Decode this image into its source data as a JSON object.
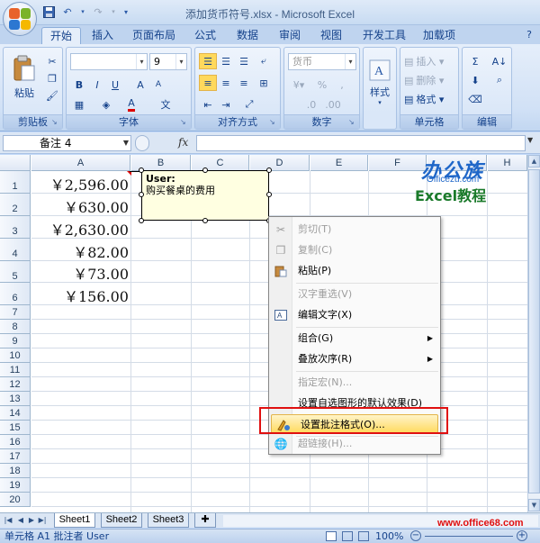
{
  "window": {
    "title": "添加货币符号.xlsx - Microsoft Excel"
  },
  "ribbon": {
    "tabs": [
      "开始",
      "插入",
      "页面布局",
      "公式",
      "数据",
      "审阅",
      "视图",
      "开发工具",
      "加载项"
    ],
    "active_tab": "开始",
    "groups": {
      "clipboard": {
        "label": "剪贴板",
        "paste_label": "粘贴"
      },
      "font": {
        "label": "字体",
        "font_size": "9",
        "bold": "B",
        "italic": "I",
        "underline": "U",
        "phonetic": "文"
      },
      "alignment": {
        "label": "对齐方式"
      },
      "number": {
        "label": "数字",
        "format": "货币",
        "percent": "%",
        "comma": ","
      },
      "styles": {
        "label": "样式"
      },
      "cells": {
        "label": "单元格",
        "insert": "插入",
        "delete": "删除",
        "format": "格式"
      },
      "editing": {
        "label": "编辑",
        "sum": "Σ"
      }
    }
  },
  "formula_bar": {
    "name_box": "备注 4",
    "fx": "fx",
    "formula": ""
  },
  "grid": {
    "columns": [
      "A",
      "B",
      "C",
      "D",
      "E",
      "F",
      "H"
    ],
    "rows": [
      "1",
      "2",
      "3",
      "4",
      "5",
      "6",
      "7",
      "8",
      "9",
      "10",
      "11",
      "12",
      "13",
      "14",
      "15",
      "16",
      "17",
      "18",
      "19",
      "20"
    ],
    "cells_A": [
      "￥2,596.00",
      "￥630.00",
      "￥2,630.00",
      "￥82.00",
      "￥73.00",
      "￥156.00"
    ]
  },
  "comment": {
    "author": "User:",
    "text": "购买餐桌的费用"
  },
  "context_menu": {
    "items": [
      {
        "label": "剪切(T)",
        "icon": "scissors-icon",
        "disabled": true
      },
      {
        "label": "复制(C)",
        "icon": "copy-icon",
        "disabled": true
      },
      {
        "label": "粘贴(P)",
        "icon": "paste-icon",
        "disabled": false
      },
      {
        "label": "汉字重选(V)",
        "icon": "",
        "disabled": true
      },
      {
        "label": "编辑文字(X)",
        "icon": "edit-text-icon",
        "disabled": false
      },
      {
        "label": "组合(G)",
        "icon": "",
        "disabled": false,
        "submenu": true
      },
      {
        "label": "叠放次序(R)",
        "icon": "",
        "disabled": false,
        "submenu": true
      },
      {
        "label": "指定宏(N)...",
        "icon": "",
        "disabled": true
      },
      {
        "label": "设置自选图形的默认效果(D)",
        "icon": "",
        "disabled": false
      },
      {
        "label": "设置批注格式(O)...",
        "icon": "format-comment-icon",
        "disabled": false,
        "highlighted": true
      },
      {
        "label": "超链接(H)...",
        "icon": "hyperlink-icon",
        "disabled": true
      }
    ]
  },
  "sheets": {
    "tabs": [
      "Sheet1",
      "Sheet2",
      "Sheet3"
    ],
    "active": "Sheet1"
  },
  "status_bar": {
    "text": "单元格 A1 批注者 User",
    "zoom": "100%"
  },
  "watermark": {
    "logo_text": "办公族",
    "logo_sub": "Officezu.com",
    "excel_text": "Excel教程",
    "site_url": "www.office68.com"
  },
  "colors": {
    "ribbon_blue": "#c3daf9",
    "highlight_red": "#e01010",
    "comment_yellow": "#ffffe1"
  }
}
